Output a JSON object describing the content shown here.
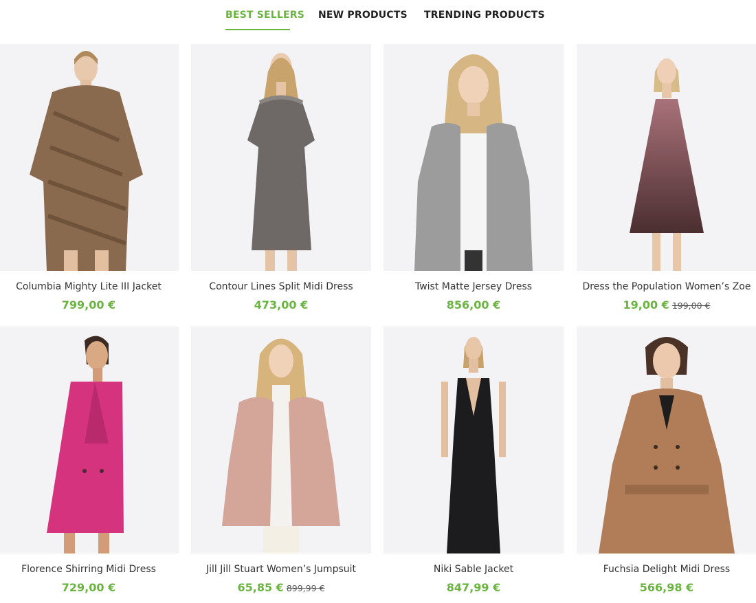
{
  "tabs": [
    {
      "label": "BEST SELLERS",
      "active": true
    },
    {
      "label": "NEW PRODUCTS",
      "active": false
    },
    {
      "label": "TRENDING PRODUCTS",
      "active": false
    }
  ],
  "colors": {
    "accent": "#6ab440",
    "image_bg": "#f3f2f5"
  },
  "products": [
    {
      "name": "Columbia Mighty Lite III Jacket",
      "price": "799,00 €",
      "old_price": ""
    },
    {
      "name": "Contour Lines Split Midi Dress",
      "price": "473,00 €",
      "old_price": ""
    },
    {
      "name": "Twist Matte Jersey Dress",
      "price": "856,00 €",
      "old_price": ""
    },
    {
      "name": "Dress the Population Women’s Zoe",
      "price": "19,00 €",
      "old_price": "199,00 €"
    },
    {
      "name": "Florence Shirring Midi Dress",
      "price": "729,00 €",
      "old_price": ""
    },
    {
      "name": "Jill Jill Stuart Women’s Jumpsuit",
      "price": "65,85 €",
      "old_price": "899,99 €"
    },
    {
      "name": "Niki Sable Jacket",
      "price": "847,99 €",
      "old_price": ""
    },
    {
      "name": "Fuchsia Delight Midi Dress",
      "price": "566,98 €",
      "old_price": ""
    }
  ]
}
